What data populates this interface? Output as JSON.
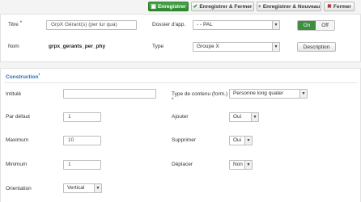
{
  "toolbar": {
    "save": "Enregistrer",
    "save_close": "Enregistrer & Fermer",
    "save_new": "Enregistrer & Nouveau",
    "close": "Fermer"
  },
  "top": {
    "title_label": "Titre",
    "title_required": "*",
    "title_value": "GrpX Gérant(s) (per lur qua)",
    "folder_label": "Dossier d'app.",
    "folder_value": "- - PAL",
    "toggle_on": "On",
    "toggle_off": "Off",
    "name_label": "Nom",
    "name_value": "grpx_gerants_per_phy",
    "type_label": "Type",
    "type_value": "Groupe X",
    "description_button": "Description"
  },
  "construction": {
    "title": "Construction",
    "title_marker": "¹",
    "intitule_label": "Intitulé",
    "intitule_value": "",
    "content_type_label": "Type de contenu (form.)",
    "content_type_required": "*",
    "content_type_value": "Personne long quater",
    "default_label": "Par défaut",
    "default_value": "1",
    "add_label": "Ajouter",
    "add_value": "Oui",
    "max_label": "Maximum",
    "max_value": "10",
    "delete_label": "Supprimer",
    "delete_value": "Oui",
    "min_label": "Minimum",
    "min_value": "1",
    "move_label": "Déplacer",
    "move_value": "Non",
    "orientation_label": "Orientation",
    "orientation_value": "Vertical"
  },
  "colors": {
    "primary_green": "#2d8a2d",
    "section_blue": "#2a6fb3"
  },
  "icons": {
    "save": "save-icon",
    "save_close": "check-icon",
    "save_new": "plus-icon",
    "close": "close-icon"
  }
}
